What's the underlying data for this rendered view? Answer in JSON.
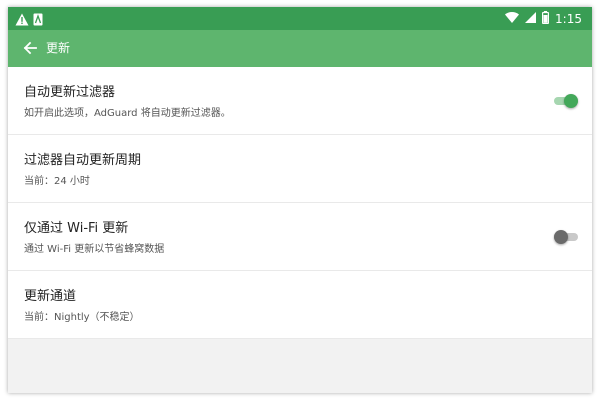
{
  "status_bar": {
    "time": "1:15",
    "left_icons": [
      "warning-icon",
      "notification-icon"
    ],
    "right_icons": [
      "wifi-icon",
      "signal-icon",
      "battery-icon"
    ]
  },
  "toolbar": {
    "title": "更新",
    "back_icon": "arrow-back-icon"
  },
  "settings": [
    {
      "title": "自动更新过滤器",
      "subtitle": "如开启此选项，AdGuard 将自动更新过滤器。",
      "toggle": "on"
    },
    {
      "title": "过滤器自动更新周期",
      "subtitle": "当前：24 小时"
    },
    {
      "title": "仅通过 Wi-Fi 更新",
      "subtitle": "通过 Wi-Fi 更新以节省蜂窝数据",
      "toggle": "off"
    },
    {
      "title": "更新通道",
      "subtitle": "当前：Nightly（不稳定）"
    }
  ],
  "colors": {
    "status_bar": "#399d54",
    "toolbar": "#5eb56e",
    "accent": "#43a85a",
    "background": "#f2f2f2"
  }
}
